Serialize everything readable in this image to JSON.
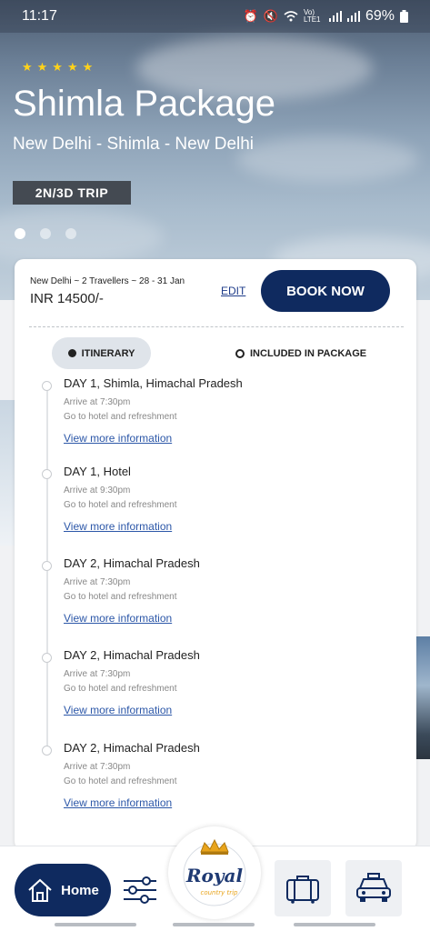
{
  "status_bar": {
    "time": "11:17",
    "network": "Vo) LTE1",
    "battery": "69%"
  },
  "hero": {
    "rating": "★★★★★",
    "title": "Shimla Package",
    "route": "New Delhi - Shimla - New Delhi",
    "trip_badge": "2N/3D TRIP",
    "carousel_count": 3,
    "carousel_active": 1
  },
  "booking": {
    "meta": "New Delhi ~ 2 Travellers ~ 28 - 31 Jan",
    "price": "INR 14500/-",
    "edit_label": "EDIT",
    "book_label": "BOOK NOW"
  },
  "tabs": {
    "itinerary": "ITINERARY",
    "included": "INCLUDED IN PACKAGE"
  },
  "itinerary": [
    {
      "heading": "DAY 1, Shimla, Himachal Pradesh",
      "arrive": "Arrive at 7:30pm",
      "note": "Go to hotel and refreshment",
      "more": "View more information"
    },
    {
      "heading": "DAY 1, Hotel",
      "arrive": "Arrive at 9:30pm",
      "note": "Go to hotel and refreshment",
      "more": "View more information"
    },
    {
      "heading": "DAY 2, Himachal Pradesh",
      "arrive": "Arrive at 7:30pm",
      "note": "Go to hotel and refreshment",
      "more": "View more information"
    },
    {
      "heading": "DAY 2, Himachal Pradesh",
      "arrive": "Arrive at 7:30pm",
      "note": "Go to hotel and refreshment",
      "more": "View more information"
    },
    {
      "heading": "DAY 2, Himachal Pradesh",
      "arrive": "Arrive at 7:30pm",
      "note": "Go to hotel and refreshment",
      "more": "View more information"
    }
  ],
  "bottom_nav": {
    "home_label": "Home",
    "logo_text": "Royal",
    "logo_subtext": "country trip"
  },
  "colors": {
    "primary": "#0f2a5f",
    "link": "#2c57a8",
    "star": "#ffd21a",
    "logo_gold": "#e8a41c"
  }
}
